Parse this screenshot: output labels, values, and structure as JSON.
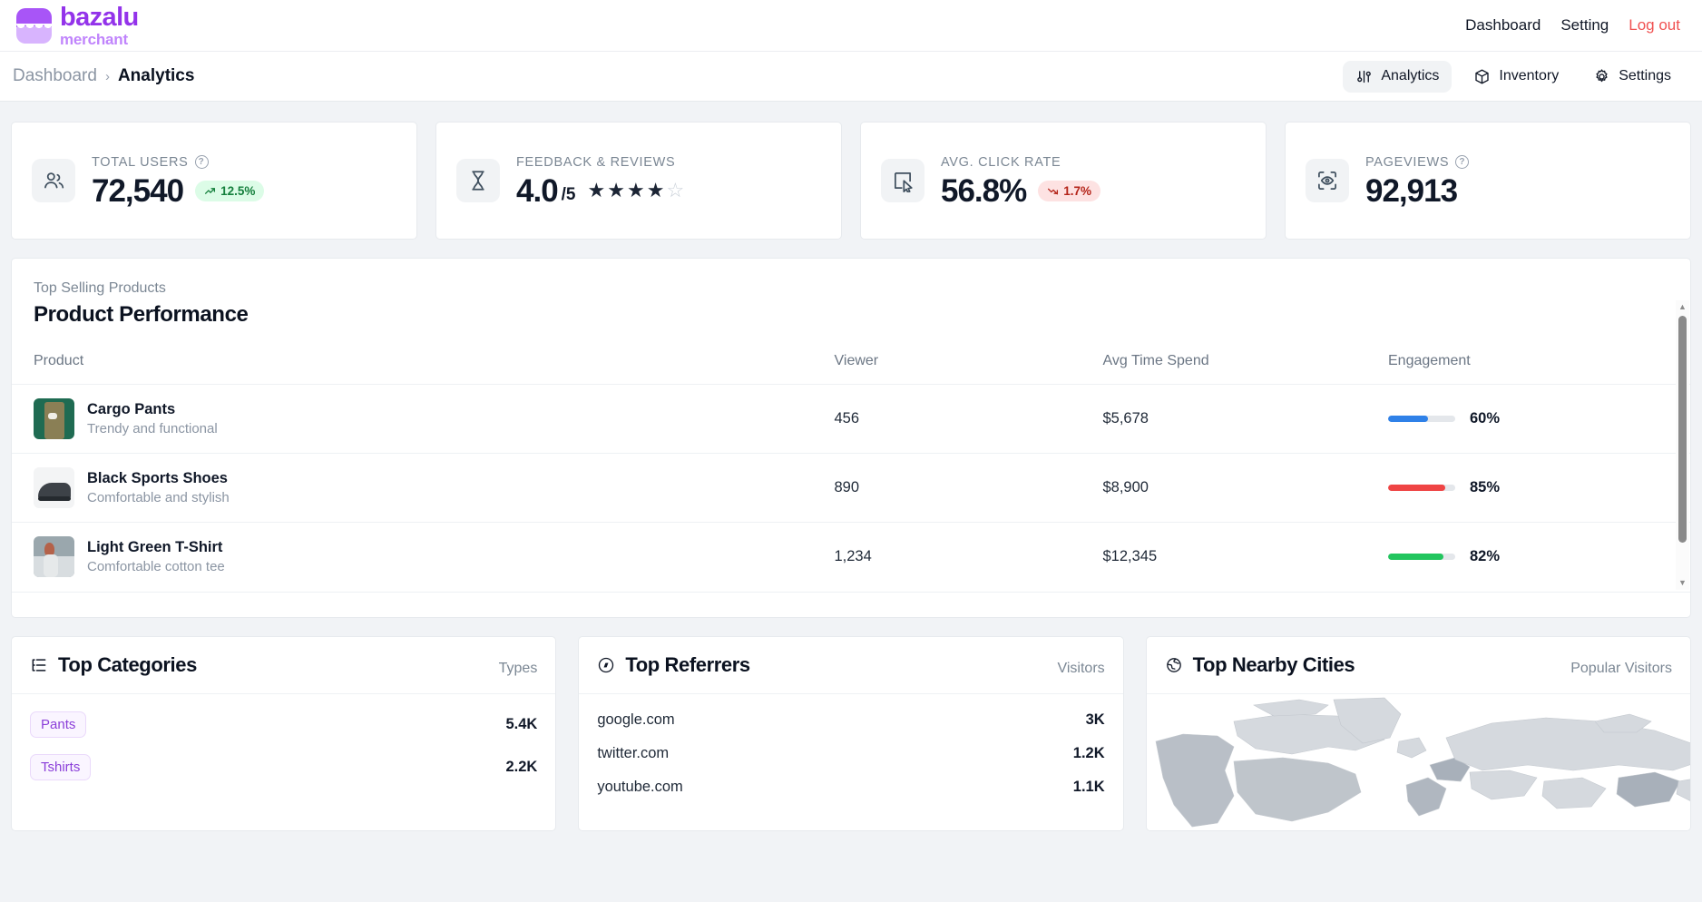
{
  "brand": {
    "name": "bazalu",
    "sub": "merchant"
  },
  "topnav": [
    {
      "label": "Dashboard",
      "kind": "link"
    },
    {
      "label": "Setting",
      "kind": "link"
    },
    {
      "label": "Log out",
      "kind": "logout"
    }
  ],
  "breadcrumb": {
    "parent": "Dashboard",
    "separator": "›",
    "current": "Analytics"
  },
  "subnav": [
    {
      "label": "Analytics",
      "icon": "analytics-icon",
      "active": true
    },
    {
      "label": "Inventory",
      "icon": "box-icon",
      "active": false
    },
    {
      "label": "Settings",
      "icon": "gear-icon",
      "active": false
    }
  ],
  "stats": [
    {
      "label": "TOTAL USERS",
      "value": "72,540",
      "icon": "users-icon",
      "has_help": true,
      "trend": "12.5%",
      "trend_dir": "up",
      "trend_color": "#15803d",
      "trend_bg": "#dcfce7"
    },
    {
      "label": "FEEDBACK & REVIEWS",
      "value": "4.0",
      "suffix": "/5",
      "icon": "hourglass-icon",
      "has_help": false,
      "rating": 4,
      "rating_max": 5
    },
    {
      "label": "AVG. CLICK RATE",
      "value": "56.8%",
      "icon": "cursor-click-icon",
      "has_help": false,
      "trend": "1.7%",
      "trend_dir": "down",
      "trend_color": "#b42318",
      "trend_bg": "#fde2e2"
    },
    {
      "label": "PAGEVIEWS",
      "value": "92,913",
      "icon": "eye-scan-icon",
      "has_help": true
    }
  ],
  "products_panel": {
    "eyebrow": "Top Selling Products",
    "title": "Product Performance",
    "columns": [
      "Product",
      "Viewer",
      "Avg Time Spend",
      "Engagement"
    ],
    "rows": [
      {
        "name": "Cargo Pants",
        "desc": "Trendy and functional",
        "viewer": "456",
        "time_spend": "$5,678",
        "engagement_pct": "60%",
        "engagement_value": 60,
        "bar_color": "#2f81e8",
        "thumb_a": "#1f6b52",
        "thumb_b": "#8a7f55"
      },
      {
        "name": "Black Sports Shoes",
        "desc": "Comfortable and stylish",
        "viewer": "890",
        "time_spend": "$8,900",
        "engagement_pct": "85%",
        "engagement_value": 85,
        "bar_color": "#ef4444",
        "thumb_a": "#f2f3f4",
        "thumb_b": "#3d4248"
      },
      {
        "name": "Light Green T-Shirt",
        "desc": "Comfortable cotton tee",
        "viewer": "1,234",
        "time_spend": "$12,345",
        "engagement_pct": "82%",
        "engagement_value": 82,
        "bar_color": "#22c55e",
        "thumb_a": "#9aa7ad",
        "thumb_b": "#b4624a"
      }
    ]
  },
  "bottom_panels": {
    "categories": {
      "title": "Top Categories",
      "icon": "list-tree-icon",
      "meta": "Types",
      "rows": [
        {
          "label": "Pants",
          "value": "5.4K"
        },
        {
          "label": "Tshirts",
          "value": "2.2K"
        }
      ]
    },
    "referrers": {
      "title": "Top Referrers",
      "icon": "compass-icon",
      "meta": "Visitors",
      "rows": [
        {
          "label": "google.com",
          "value": "3K"
        },
        {
          "label": "twitter.com",
          "value": "1.2K"
        },
        {
          "label": "youtube.com",
          "value": "1.1K"
        }
      ]
    },
    "cities": {
      "title": "Top Nearby Cities",
      "icon": "globe-icon",
      "meta": "Popular Visitors"
    }
  }
}
